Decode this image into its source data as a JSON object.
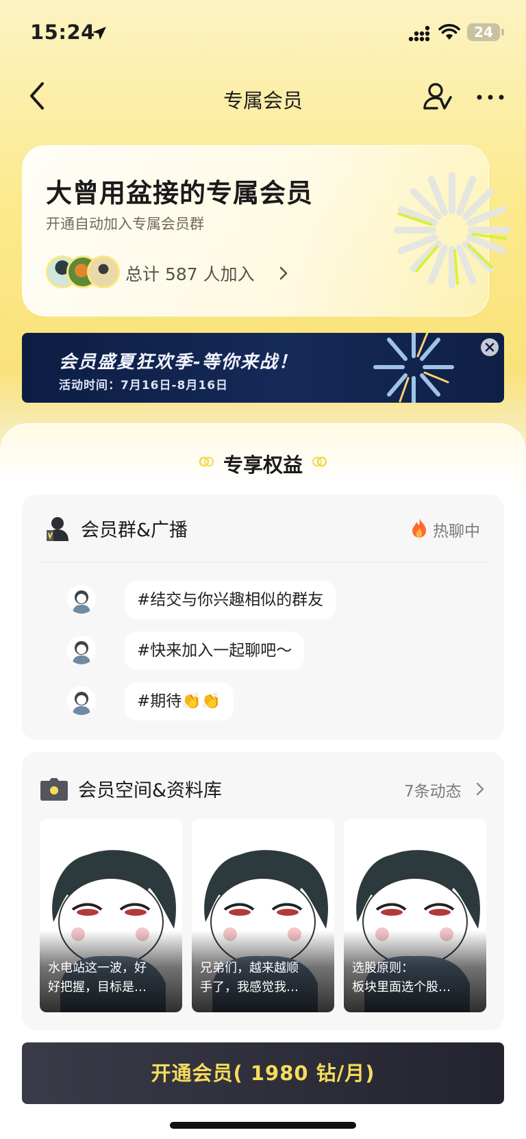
{
  "status_bar": {
    "time": "15:24",
    "battery": "24"
  },
  "nav": {
    "title": "专属会员"
  },
  "header": {
    "title": "大曾用盆接的专属会员",
    "subtitle": "开通自动加入专属会员群",
    "join_text": "总计 587 人加入"
  },
  "promo": {
    "title": "会员盛夏狂欢季-等你来战！",
    "date": "活动时间：7月16日-8月16日"
  },
  "benefits": {
    "section_title": "专享权益",
    "group_card": {
      "title": "会员群&广播",
      "status": "热聊中",
      "messages": [
        "#结交与你兴趣相似的群友",
        "#快来加入一起聊吧～",
        "#期待👏👏"
      ]
    },
    "space_card": {
      "title": "会员空间&资料库",
      "count": "7条动态",
      "posts": [
        {
          "line1": "水电站这一波，好",
          "line2": "好把握，目标是…"
        },
        {
          "line1": "兄弟们，越来越顺",
          "line2": "手了，我感觉我…"
        },
        {
          "line1": "选股原则：",
          "line2": "板块里面选个股…"
        }
      ]
    }
  },
  "cta": {
    "label": "开通会员( 1980 钻/月)"
  },
  "colors": {
    "accent_yellow": "#fbe98a",
    "cta_text": "#f7dc5a",
    "cta_bg": "#2c2d39",
    "promo_bg": "#142758"
  }
}
